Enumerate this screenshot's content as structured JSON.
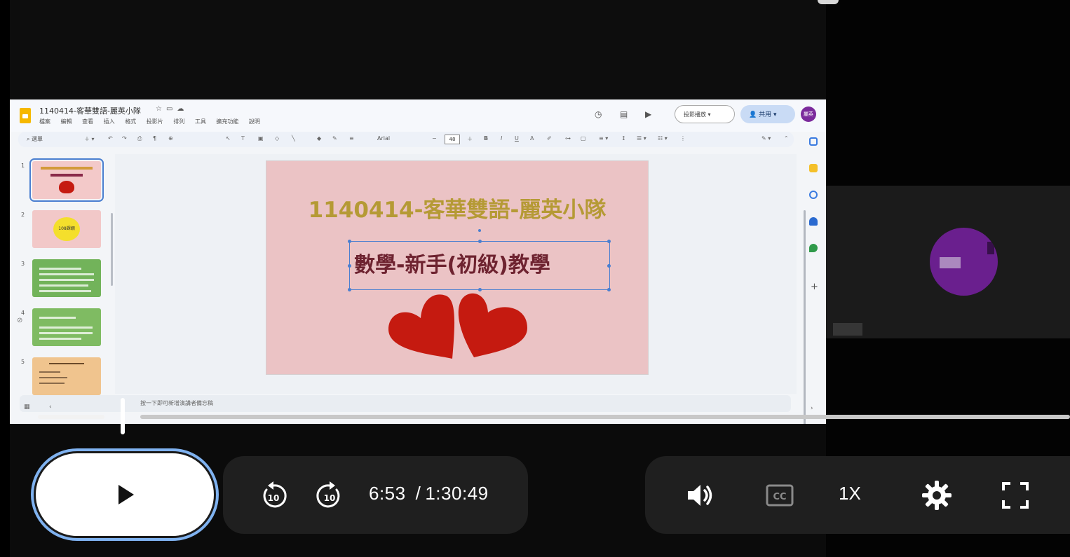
{
  "slides_app": {
    "doc_title": "1140414-客華雙語-麗英小隊",
    "menu": [
      "檔案",
      "編輯",
      "查看",
      "插入",
      "格式",
      "投影片",
      "排列",
      "工具",
      "擴充功能",
      "說明"
    ],
    "present_label": "投影播放",
    "share_label": "共用",
    "user_initials": "麗英",
    "toolbar": {
      "search_label": "選單",
      "font": "Arial",
      "font_size": "48"
    },
    "thumbnails": [
      {
        "num": "1"
      },
      {
        "num": "2",
        "label": "108課綱"
      },
      {
        "num": "3"
      },
      {
        "num": "4"
      },
      {
        "num": "5"
      }
    ],
    "slide": {
      "title": "1140414-客華雙語-麗英小隊",
      "subtitle": "數學-新手(初級)教學"
    },
    "notes_placeholder": "按一下即可新增演講者備忘稿"
  },
  "player": {
    "progress_fraction": 0.076,
    "current_time": "6:53",
    "separator": "/",
    "duration": "1:30:49",
    "speed_label": "1X",
    "icons": [
      "play-icon",
      "rewind-10-icon",
      "forward-10-icon",
      "volume-icon",
      "captions-icon",
      "settings-gear-icon",
      "fullscreen-icon"
    ],
    "colors": {
      "focus_ring": "#7fb2f0",
      "avatar": "#6a1f8e",
      "slide_title": "#b59a35",
      "slide_subtitle": "#6e2330",
      "heart": "#c51a10"
    }
  }
}
